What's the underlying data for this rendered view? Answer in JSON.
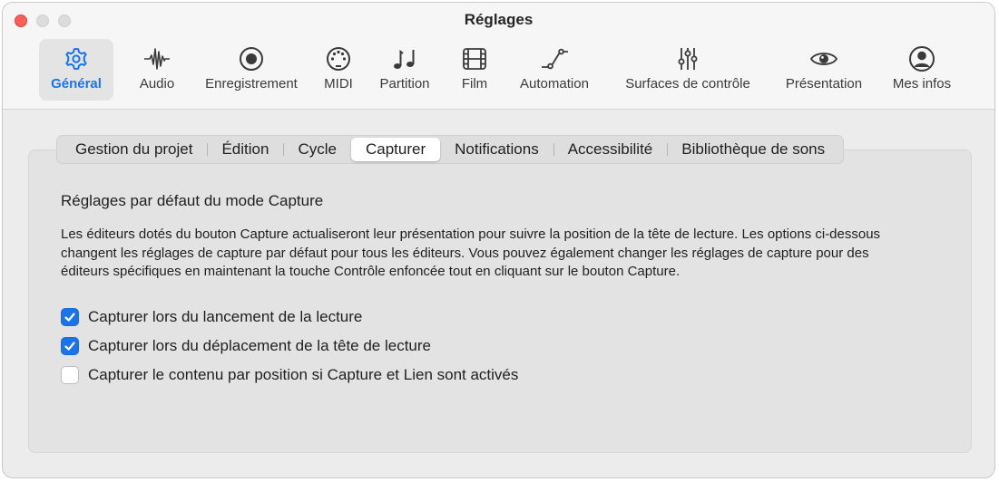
{
  "window": {
    "title": "Réglages"
  },
  "toolbar": {
    "items": [
      {
        "label": "Général",
        "icon": "gear-icon",
        "active": true
      },
      {
        "label": "Audio",
        "icon": "waveform-icon"
      },
      {
        "label": "Enregistrement",
        "icon": "record-icon"
      },
      {
        "label": "MIDI",
        "icon": "midi-connector-icon"
      },
      {
        "label": "Partition",
        "icon": "music-notes-icon"
      },
      {
        "label": "Film",
        "icon": "film-icon"
      },
      {
        "label": "Automation",
        "icon": "automation-curve-icon"
      },
      {
        "label": "Surfaces de contrôle",
        "icon": "sliders-icon"
      },
      {
        "label": "Présentation",
        "icon": "eye-icon"
      },
      {
        "label": "Mes infos",
        "icon": "person-icon"
      }
    ]
  },
  "tabs": [
    {
      "label": "Gestion du projet"
    },
    {
      "label": "Édition"
    },
    {
      "label": "Cycle"
    },
    {
      "label": "Capturer",
      "selected": true
    },
    {
      "label": "Notifications"
    },
    {
      "label": "Accessibilité"
    },
    {
      "label": "Bibliothèque de sons"
    }
  ],
  "content": {
    "section_title": "Réglages par défaut du mode Capture",
    "description": "Les éditeurs dotés du bouton Capture actualiseront leur présentation pour suivre la position de la tête de lecture. Les options ci-dessous changent les réglages de capture par défaut pour tous les éditeurs. Vous pouvez également changer les réglages de capture pour des éditeurs spécifiques en maintenant la touche Contrôle enfoncée tout en cliquant sur le bouton Capture.",
    "checkboxes": [
      {
        "label": "Capturer lors du lancement de la lecture",
        "checked": true
      },
      {
        "label": "Capturer lors du déplacement de la tête de lecture",
        "checked": true
      },
      {
        "label": "Capturer le contenu par position si Capture et Lien sont activés",
        "checked": false
      }
    ]
  },
  "colors": {
    "accent": "#1a73e8",
    "close_button": "#fe5f57"
  }
}
